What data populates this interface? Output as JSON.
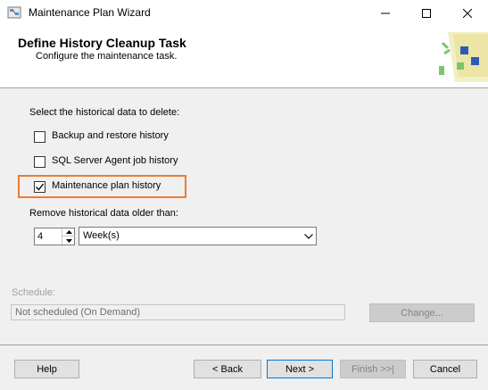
{
  "window": {
    "title": "Maintenance Plan Wizard"
  },
  "header": {
    "title": "Define History Cleanup Task",
    "subtitle": "Configure the maintenance task."
  },
  "content": {
    "select_label": "Select the historical data to delete:",
    "checkboxes": [
      {
        "label": "Backup and restore history",
        "checked": false
      },
      {
        "label": "SQL Server Agent job history",
        "checked": false
      },
      {
        "label": "Maintenance plan history",
        "checked": true
      }
    ],
    "remove_label": "Remove historical data older than:",
    "age_value": "4",
    "age_unit": "Week(s)"
  },
  "schedule": {
    "label": "Schedule:",
    "value": "Not scheduled (On Demand)",
    "change_label": "Change..."
  },
  "footer": {
    "help": "Help",
    "back": "< Back",
    "next": "Next >",
    "finish": "Finish >>|",
    "cancel": "Cancel"
  },
  "colors": {
    "highlight_border": "#ed7d31",
    "default_button_border": "#0078d7"
  },
  "icons": {
    "app": "wizard-app-icon",
    "header_art": "wizard-banner-icon"
  }
}
